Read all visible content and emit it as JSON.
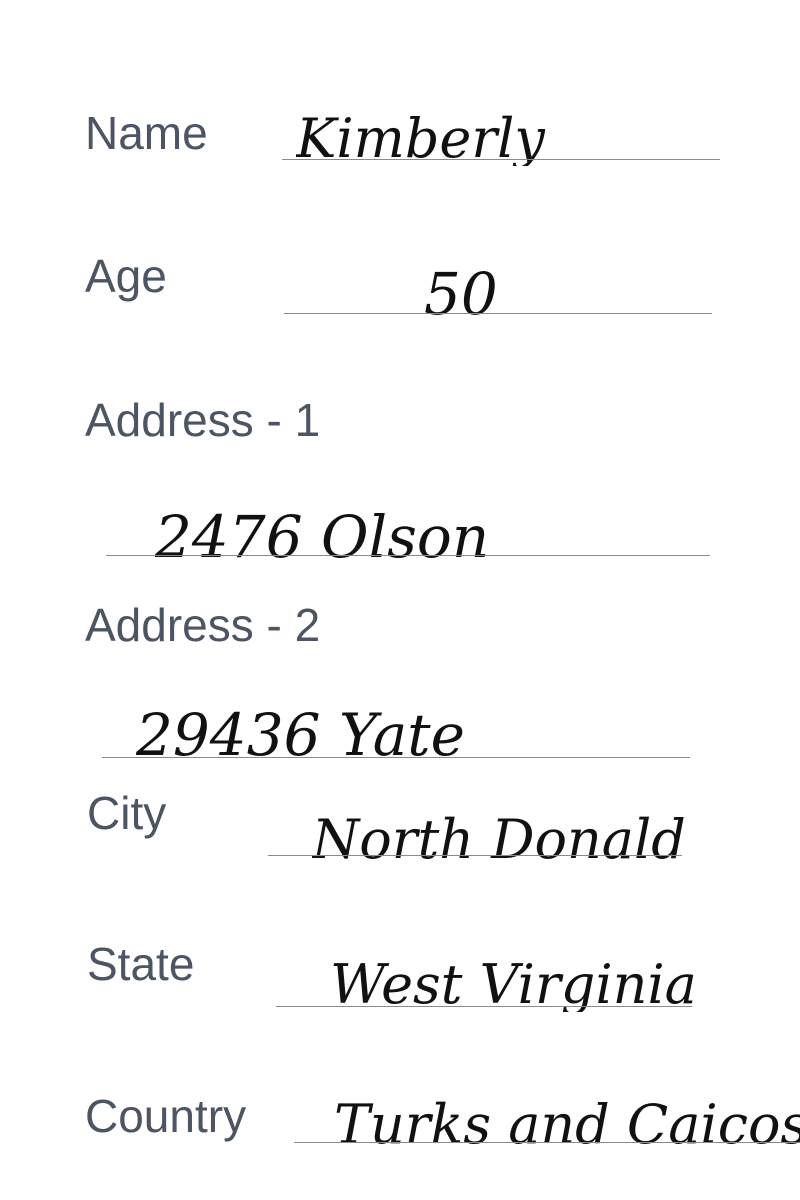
{
  "form": {
    "name_label": "Name",
    "name_value": "Kimberly",
    "age_label": "Age",
    "age_value": "50",
    "address1_label": "Address - 1",
    "address1_value": "2476 Olson",
    "address2_label": "Address - 2",
    "address2_value": "29436 Yate",
    "city_label": "City",
    "city_value": "North Donald",
    "state_label": "State",
    "state_value": "West Virginia",
    "country_label": "Country",
    "country_value": "Turks and Caicos Is"
  }
}
